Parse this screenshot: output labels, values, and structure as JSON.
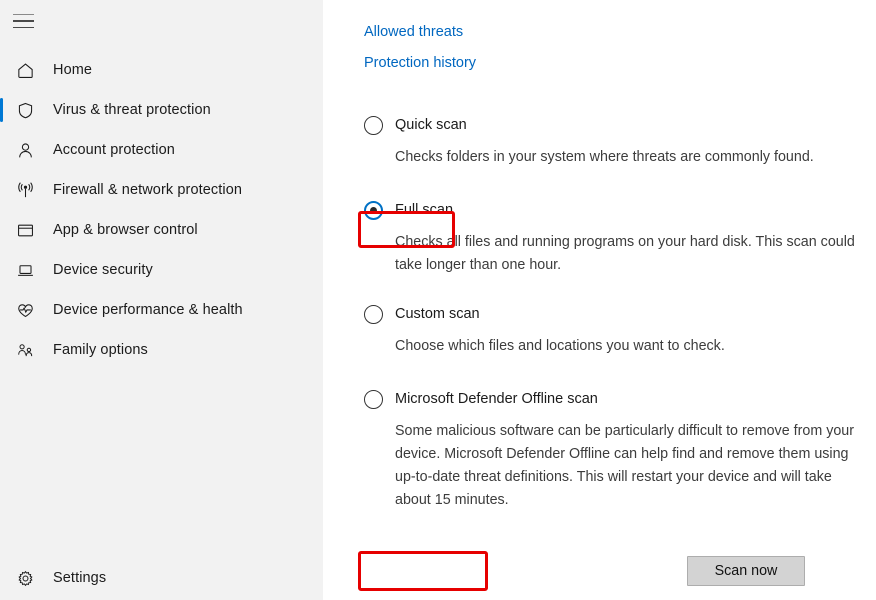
{
  "sidebar": {
    "menu_button": "hamburger-menu",
    "items": [
      {
        "label": "Home",
        "icon": "home-icon",
        "selected": false
      },
      {
        "label": "Virus & threat protection",
        "icon": "shield-icon",
        "selected": true
      },
      {
        "label": "Account protection",
        "icon": "person-icon",
        "selected": false
      },
      {
        "label": "Firewall & network protection",
        "icon": "wifi-signal-icon",
        "selected": false
      },
      {
        "label": "App & browser control",
        "icon": "browser-window-icon",
        "selected": false
      },
      {
        "label": "Device security",
        "icon": "laptop-icon",
        "selected": false
      },
      {
        "label": "Device performance & health",
        "icon": "heart-pulse-icon",
        "selected": false
      },
      {
        "label": "Family options",
        "icon": "family-people-icon",
        "selected": false
      }
    ],
    "settings": {
      "label": "Settings",
      "icon": "gear-icon"
    }
  },
  "main": {
    "links": [
      {
        "label": "Allowed threats"
      },
      {
        "label": "Protection history"
      }
    ],
    "scan_options": [
      {
        "label": "Quick scan",
        "description": "Checks folders in your system where threats are commonly found.",
        "checked": false
      },
      {
        "label": "Full scan",
        "description": "Checks all files and running programs on your hard disk. This scan could take longer than one hour.",
        "checked": true
      },
      {
        "label": "Custom scan",
        "description": "Choose which files and locations you want to check.",
        "checked": false
      },
      {
        "label": "Microsoft Defender Offline scan",
        "description": "Some malicious software can be particularly difficult to remove from your device. Microsoft Defender Offline can help find and remove them using up-to-date threat definitions. This will restart your device and will take about 15 minutes.",
        "checked": false
      }
    ],
    "scan_now_button": "Scan now"
  },
  "colors": {
    "accent": "#0078d4",
    "link": "#0067c0",
    "highlight": "#e60000",
    "sidebar_bg": "#f2f2f2",
    "main_bg": "#ffffff"
  }
}
